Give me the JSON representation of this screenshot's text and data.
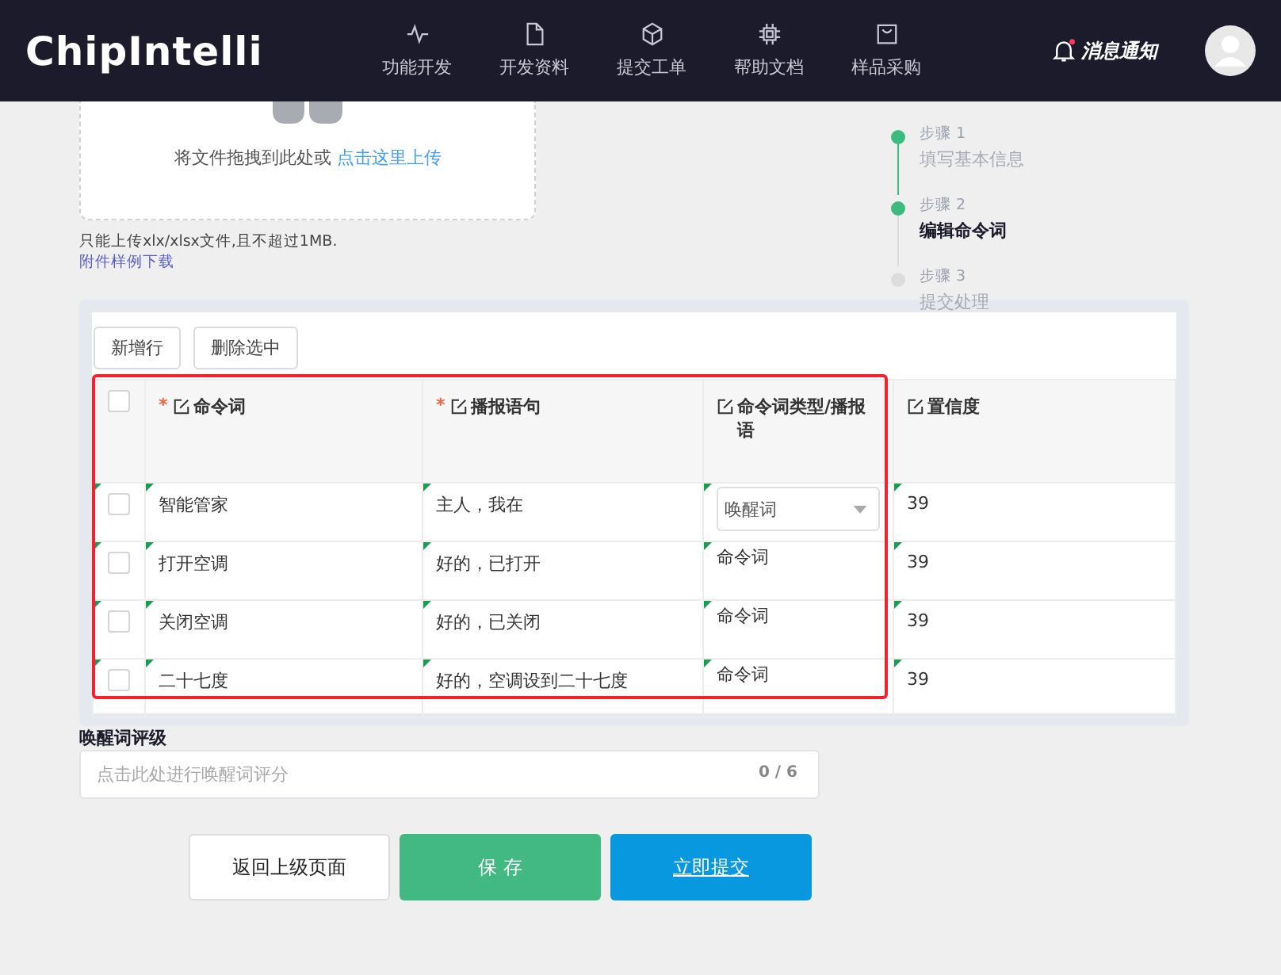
{
  "header": {
    "logo": "ChipIntelli",
    "nav": [
      {
        "label": "功能开发"
      },
      {
        "label": "开发资料"
      },
      {
        "label": "提交工单"
      },
      {
        "label": "帮助文档"
      },
      {
        "label": "样品采购"
      }
    ],
    "notification": {
      "label": "消息通知",
      "unread": true
    }
  },
  "upload": {
    "prompt": "将文件拖拽到此处或",
    "link": "点击这里上传",
    "hint": "只能上传xlx/xlsx文件,且不超过1MB.",
    "sample_link": "附件样例下载"
  },
  "steps": [
    {
      "step": "步骤 1",
      "title": "填写基本信息",
      "kind": "done"
    },
    {
      "step": "步骤 2",
      "title": "编辑命令词",
      "kind": "current"
    },
    {
      "step": "步骤 3",
      "title": "提交处理",
      "kind": "todo"
    }
  ],
  "table": {
    "buttons": [
      "新增行",
      "删除选中"
    ],
    "all_checked": false,
    "columns": [
      {
        "label": "命令词",
        "required_mark": "*"
      },
      {
        "label": "播报语句",
        "required_mark": "*"
      },
      {
        "label": "命令词类型/播报语"
      },
      {
        "label": "置信度"
      }
    ],
    "rows": [
      {
        "checked": false,
        "modified": true,
        "command": "智能管家",
        "reply": "主人，我在",
        "type": "唤醒词",
        "kind": "select",
        "confidence": "39"
      },
      {
        "checked": false,
        "modified": true,
        "command": "打开空调",
        "reply": "好的，已打开",
        "type": "命令词",
        "kind": "text",
        "confidence": "39"
      },
      {
        "checked": false,
        "modified": true,
        "command": "关闭空调",
        "reply": "好的，已关闭",
        "type": "命令词",
        "kind": "text",
        "confidence": "39"
      },
      {
        "checked": false,
        "modified": true,
        "command": "二十七度",
        "reply": "好的，空调设到二十七度",
        "type": "命令词",
        "kind": "text",
        "confidence": "39"
      }
    ],
    "highlighted": true
  },
  "rating": {
    "label": "唤醒词评级",
    "placeholder": "点击此处进行唤醒词评分",
    "count": "0 / 6"
  },
  "actions": [
    {
      "label": "返回上级页面",
      "kind": "default"
    },
    {
      "label": "保 存",
      "kind": "success"
    },
    {
      "label": "立即提交",
      "kind": "primary"
    }
  ]
}
